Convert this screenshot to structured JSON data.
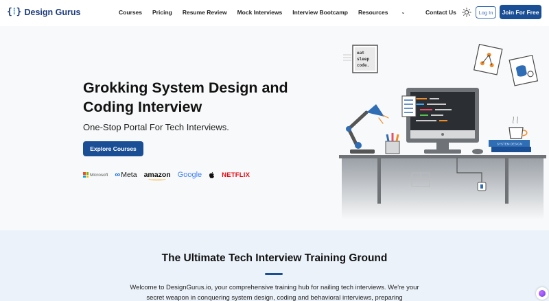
{
  "header": {
    "logo_mark": "{ }",
    "logo_text": "Design Gurus",
    "nav": [
      "Courses",
      "Pricing",
      "Resume Review",
      "Mock Interviews",
      "Interview Bootcamp",
      "Resources"
    ],
    "contact": "Contact Us",
    "login": "Log In",
    "join": "Join For Free"
  },
  "hero": {
    "title": "Grokking System Design and Coding Interview",
    "subtitle": "One-Stop Portal For Tech Interviews.",
    "cta": "Explore Courses",
    "brands": {
      "microsoft": "Microsoft",
      "meta": "Meta",
      "amazon": "amazon",
      "google": "Google",
      "netflix": "NETFLIX"
    },
    "illustration": {
      "note_lines": [
        "eat",
        "sleep",
        "code."
      ],
      "books_label": "SYSTEM DESIGN"
    }
  },
  "intro": {
    "title": "The Ultimate Tech Interview Training Ground",
    "body": "Welcome to DesignGurus.io, your comprehensive training hub for nailing tech interviews. We're your secret weapon in conquering system design, coding and behavioral interviews, preparing"
  },
  "colors": {
    "primary": "#1a4f96",
    "logo": "#1a3a7a",
    "hero_bg": "#f8f9fa",
    "section_bg": "#ebf2fa"
  },
  "icons": [
    "logo-icon",
    "chevron-down-icon",
    "sun-icon",
    "microsoft-icon",
    "meta-icon",
    "apple-icon",
    "assistant-icon"
  ]
}
